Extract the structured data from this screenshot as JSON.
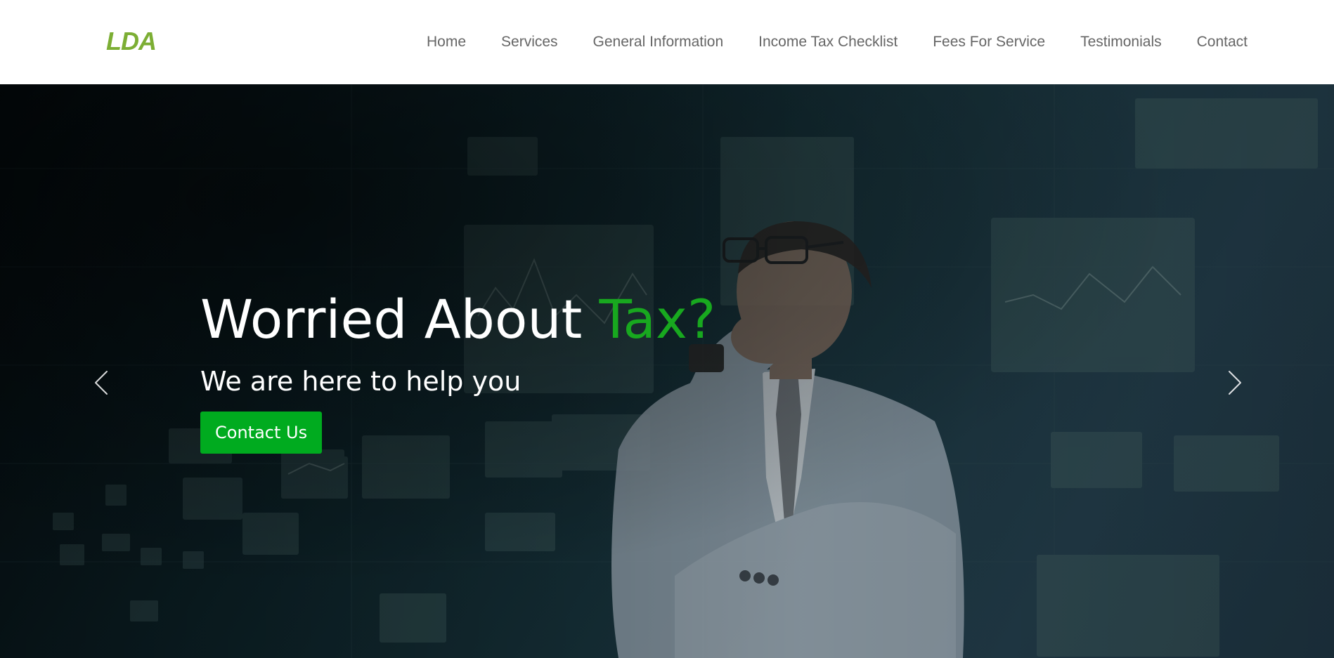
{
  "header": {
    "logo": "LDA",
    "nav": [
      {
        "label": "Home"
      },
      {
        "label": "Services"
      },
      {
        "label": "General Information"
      },
      {
        "label": "Income Tax Checklist"
      },
      {
        "label": "Fees For Service"
      },
      {
        "label": "Testimonials"
      },
      {
        "label": "Contact"
      }
    ]
  },
  "hero": {
    "title_main": "Worried About ",
    "title_accent": "Tax?",
    "subtitle": "We are here to help you",
    "button_label": "Contact Us",
    "prev_icon": "chevron-left-icon",
    "next_icon": "chevron-right-icon"
  },
  "colors": {
    "logo": "#7cae34",
    "accent": "#18a81f",
    "button": "#00ab1f",
    "nav_text": "#666666"
  }
}
